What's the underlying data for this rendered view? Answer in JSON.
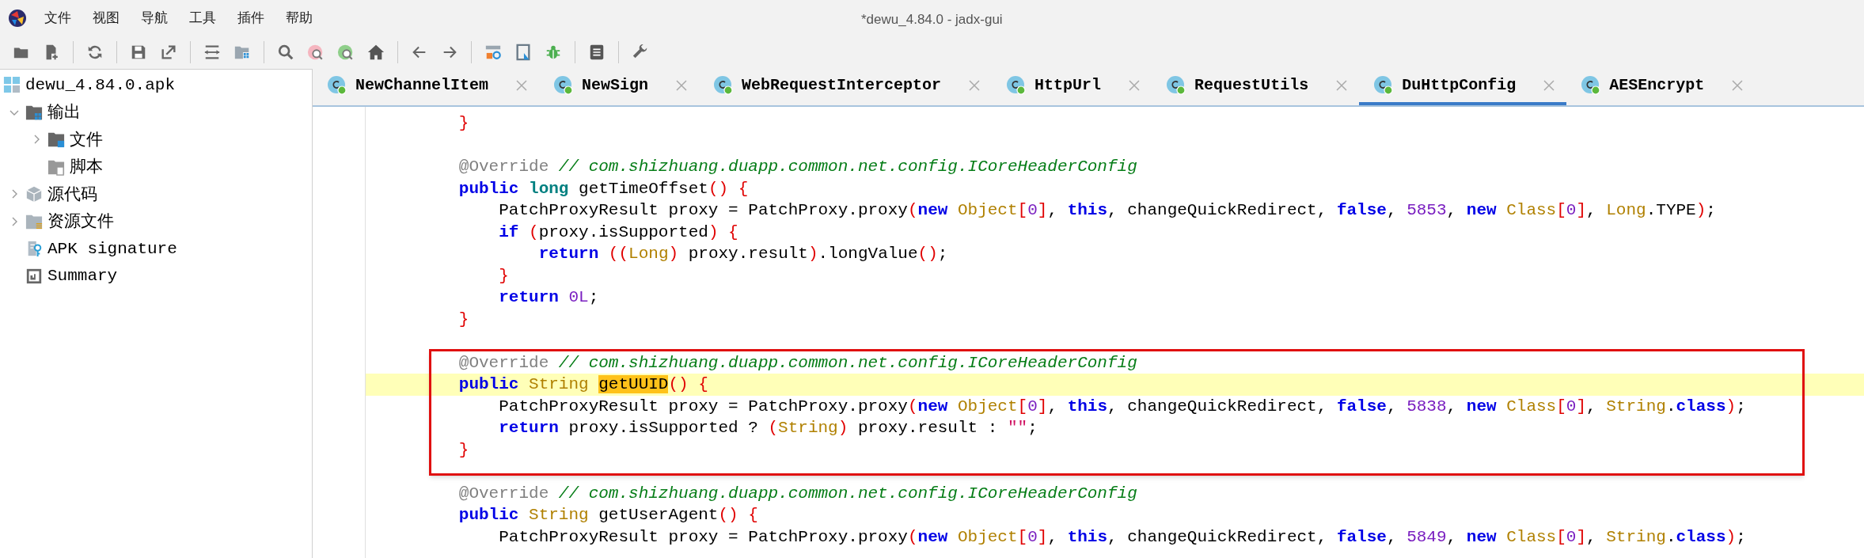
{
  "window": {
    "title": "*dewu_4.84.0 - jadx-gui"
  },
  "menu": [
    "文件",
    "视图",
    "导航",
    "工具",
    "插件",
    "帮助"
  ],
  "tree": [
    {
      "label": "dewu_4.84.0.apk",
      "kind": "apk",
      "children": [
        {
          "label": "输出",
          "kind": "output",
          "expanded": true,
          "children": [
            {
              "label": "文件",
              "kind": "files",
              "expanded": false
            },
            {
              "label": "脚本",
              "kind": "scripts"
            }
          ]
        },
        {
          "label": "源代码",
          "kind": "package",
          "expanded": false
        },
        {
          "label": "资源文件",
          "kind": "resources",
          "expanded": false
        },
        {
          "label": "APK signature",
          "kind": "signature"
        },
        {
          "label": "Summary",
          "kind": "summary"
        }
      ]
    }
  ],
  "tabs": [
    {
      "label": "NewChannelItem",
      "selected": false
    },
    {
      "label": "NewSign",
      "selected": false
    },
    {
      "label": "WebRequestInterceptor",
      "selected": false
    },
    {
      "label": "HttpUrl",
      "selected": false
    },
    {
      "label": "RequestUtils",
      "selected": false
    },
    {
      "label": "DuHttpConfig",
      "selected": true
    },
    {
      "label": "AESEncrypt",
      "selected": false
    }
  ],
  "code": [
    {
      "current": false,
      "tokens": [
        {
          "kind": "brace",
          "text": "        }"
        }
      ]
    },
    {
      "current": false
    },
    {
      "current": false,
      "tokens": [
        {
          "kind": "annotation",
          "text": "        @Override "
        },
        {
          "kind": "comment",
          "text": "// com.shizhuang.duapp.common.net.config.ICoreHeaderConfig"
        }
      ]
    },
    {
      "current": false,
      "tokens": [
        {
          "kind": "keyword",
          "text": "        public "
        },
        {
          "kind": "primitive",
          "text": "long "
        },
        {
          "kind": "plain",
          "text": "getTimeOffset"
        },
        {
          "kind": "brace",
          "text": "() {"
        }
      ]
    },
    {
      "current": false,
      "tokens": [
        {
          "kind": "plain",
          "text": "            PatchProxyResult proxy = PatchProxy.proxy"
        },
        {
          "kind": "brace",
          "text": "("
        },
        {
          "kind": "keyword",
          "text": "new "
        },
        {
          "kind": "type",
          "text": "Object"
        },
        {
          "kind": "brace",
          "text": "["
        },
        {
          "kind": "number",
          "text": "0"
        },
        {
          "kind": "brace",
          "text": "]"
        },
        {
          "kind": "plain",
          "text": ", "
        },
        {
          "kind": "keyword",
          "text": "this"
        },
        {
          "kind": "plain",
          "text": ", changeQuickRedirect, "
        },
        {
          "kind": "keyword",
          "text": "false"
        },
        {
          "kind": "plain",
          "text": ", "
        },
        {
          "kind": "number",
          "text": "5853"
        },
        {
          "kind": "plain",
          "text": ", "
        },
        {
          "kind": "keyword",
          "text": "new "
        },
        {
          "kind": "type",
          "text": "Class"
        },
        {
          "kind": "brace",
          "text": "["
        },
        {
          "kind": "number",
          "text": "0"
        },
        {
          "kind": "brace",
          "text": "]"
        },
        {
          "kind": "plain",
          "text": ", "
        },
        {
          "kind": "type",
          "text": "Long"
        },
        {
          "kind": "plain",
          "text": ".TYPE"
        },
        {
          "kind": "brace",
          "text": ")"
        },
        {
          "kind": "plain",
          "text": ";"
        }
      ]
    },
    {
      "current": false,
      "tokens": [
        {
          "kind": "keyword",
          "text": "            if "
        },
        {
          "kind": "brace",
          "text": "("
        },
        {
          "kind": "plain",
          "text": "proxy.isSupported"
        },
        {
          "kind": "brace",
          "text": ") {"
        }
      ]
    },
    {
      "current": false,
      "tokens": [
        {
          "kind": "keyword",
          "text": "                return "
        },
        {
          "kind": "brace",
          "text": "(("
        },
        {
          "kind": "type",
          "text": "Long"
        },
        {
          "kind": "brace",
          "text": ")"
        },
        {
          "kind": "plain",
          "text": " proxy.result"
        },
        {
          "kind": "brace",
          "text": ")"
        },
        {
          "kind": "plain",
          "text": ".longValue"
        },
        {
          "kind": "brace",
          "text": "()"
        },
        {
          "kind": "plain",
          "text": ";"
        }
      ]
    },
    {
      "current": false,
      "tokens": [
        {
          "kind": "brace",
          "text": "            }"
        }
      ]
    },
    {
      "current": false,
      "tokens": [
        {
          "kind": "keyword",
          "text": "            return "
        },
        {
          "kind": "number",
          "text": "0L"
        },
        {
          "kind": "plain",
          "text": ";"
        }
      ]
    },
    {
      "current": false,
      "tokens": [
        {
          "kind": "brace",
          "text": "        }"
        }
      ]
    },
    {
      "current": false
    },
    {
      "current": false,
      "tokens": [
        {
          "kind": "annotation",
          "text": "        @Override "
        },
        {
          "kind": "comment",
          "text": "// com.shizhuang.duapp.common.net.config.ICoreHeaderConfig"
        }
      ]
    },
    {
      "current": true,
      "tokens": [
        {
          "kind": "keyword",
          "text": "        public "
        },
        {
          "kind": "type",
          "text": "String "
        },
        {
          "kind": "match",
          "text": "getUUID"
        },
        {
          "kind": "brace",
          "text": "() {"
        }
      ]
    },
    {
      "current": false,
      "tokens": [
        {
          "kind": "plain",
          "text": "            PatchProxyResult proxy = PatchProxy.proxy"
        },
        {
          "kind": "brace",
          "text": "("
        },
        {
          "kind": "keyword",
          "text": "new "
        },
        {
          "kind": "type",
          "text": "Object"
        },
        {
          "kind": "brace",
          "text": "["
        },
        {
          "kind": "number",
          "text": "0"
        },
        {
          "kind": "brace",
          "text": "]"
        },
        {
          "kind": "plain",
          "text": ", "
        },
        {
          "kind": "keyword",
          "text": "this"
        },
        {
          "kind": "plain",
          "text": ", changeQuickRedirect, "
        },
        {
          "kind": "keyword",
          "text": "false"
        },
        {
          "kind": "plain",
          "text": ", "
        },
        {
          "kind": "number",
          "text": "5838"
        },
        {
          "kind": "plain",
          "text": ", "
        },
        {
          "kind": "keyword",
          "text": "new "
        },
        {
          "kind": "type",
          "text": "Class"
        },
        {
          "kind": "brace",
          "text": "["
        },
        {
          "kind": "number",
          "text": "0"
        },
        {
          "kind": "brace",
          "text": "]"
        },
        {
          "kind": "plain",
          "text": ", "
        },
        {
          "kind": "type",
          "text": "String"
        },
        {
          "kind": "plain",
          "text": "."
        },
        {
          "kind": "keyword",
          "text": "class"
        },
        {
          "kind": "brace",
          "text": ")"
        },
        {
          "kind": "plain",
          "text": ";"
        }
      ]
    },
    {
      "current": false,
      "tokens": [
        {
          "kind": "keyword",
          "text": "            return "
        },
        {
          "kind": "plain",
          "text": "proxy.isSupported ? "
        },
        {
          "kind": "brace",
          "text": "("
        },
        {
          "kind": "type",
          "text": "String"
        },
        {
          "kind": "brace",
          "text": ")"
        },
        {
          "kind": "plain",
          "text": " proxy.result : "
        },
        {
          "kind": "string",
          "text": "\"\""
        },
        {
          "kind": "plain",
          "text": ";"
        }
      ]
    },
    {
      "current": false,
      "tokens": [
        {
          "kind": "brace",
          "text": "        }"
        }
      ]
    },
    {
      "current": false
    },
    {
      "current": false,
      "tokens": [
        {
          "kind": "annotation",
          "text": "        @Override "
        },
        {
          "kind": "comment",
          "text": "// com.shizhuang.duapp.common.net.config.ICoreHeaderConfig"
        }
      ]
    },
    {
      "current": false,
      "tokens": [
        {
          "kind": "keyword",
          "text": "        public "
        },
        {
          "kind": "type",
          "text": "String "
        },
        {
          "kind": "plain",
          "text": "getUserAgent"
        },
        {
          "kind": "brace",
          "text": "() {"
        }
      ]
    },
    {
      "current": false,
      "tokens": [
        {
          "kind": "plain",
          "text": "            PatchProxyResult proxy = PatchProxy.proxy"
        },
        {
          "kind": "brace",
          "text": "("
        },
        {
          "kind": "keyword",
          "text": "new "
        },
        {
          "kind": "type",
          "text": "Object"
        },
        {
          "kind": "brace",
          "text": "["
        },
        {
          "kind": "number",
          "text": "0"
        },
        {
          "kind": "brace",
          "text": "]"
        },
        {
          "kind": "plain",
          "text": ", "
        },
        {
          "kind": "keyword",
          "text": "this"
        },
        {
          "kind": "plain",
          "text": ", changeQuickRedirect, "
        },
        {
          "kind": "keyword",
          "text": "false"
        },
        {
          "kind": "plain",
          "text": ", "
        },
        {
          "kind": "number",
          "text": "5849"
        },
        {
          "kind": "plain",
          "text": ", "
        },
        {
          "kind": "keyword",
          "text": "new "
        },
        {
          "kind": "type",
          "text": "Class"
        },
        {
          "kind": "brace",
          "text": "["
        },
        {
          "kind": "number",
          "text": "0"
        },
        {
          "kind": "brace",
          "text": "]"
        },
        {
          "kind": "plain",
          "text": ", "
        },
        {
          "kind": "type",
          "text": "String"
        },
        {
          "kind": "plain",
          "text": "."
        },
        {
          "kind": "keyword",
          "text": "class"
        },
        {
          "kind": "brace",
          "text": ")"
        },
        {
          "kind": "plain",
          "text": ";"
        }
      ]
    }
  ]
}
